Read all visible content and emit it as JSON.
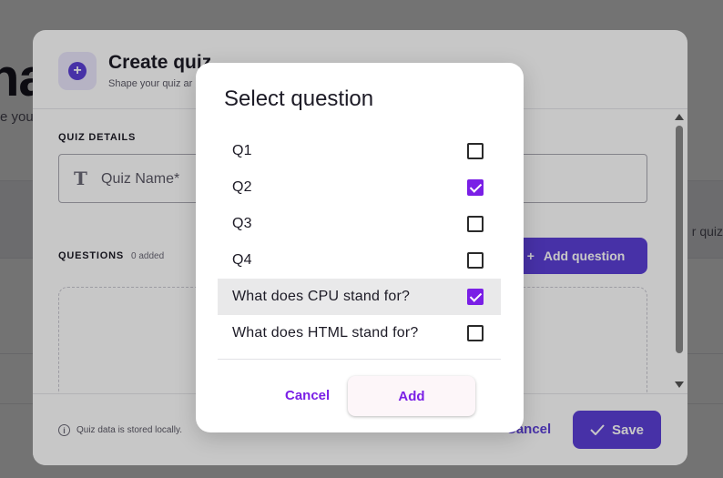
{
  "background": {
    "title_fragment": "na",
    "subtitle_fragment": "e your",
    "right_fragment": "r quiz"
  },
  "quiz_modal": {
    "title": "Create quiz",
    "subtitle": "Shape your quiz ar",
    "details_label": "QUIZ DETAILS",
    "name_placeholder": "Quiz Name*",
    "name_icon_glyph": "T",
    "questions_label": "QUESTIONS",
    "questions_count": "0 added",
    "add_question_label": "Add question",
    "footer_info": "Quiz data is stored locally.",
    "cancel_label": "Cancel",
    "save_label": "Save",
    "accent_color": "#5b3fd6"
  },
  "dialog": {
    "title": "Select question",
    "items": [
      {
        "label": "Q1",
        "checked": false
      },
      {
        "label": "Q2",
        "checked": true
      },
      {
        "label": "Q3",
        "checked": false
      },
      {
        "label": "Q4",
        "checked": false
      },
      {
        "label": "What does CPU stand for?",
        "checked": true,
        "hovered": true
      },
      {
        "label": "What does HTML stand for?",
        "checked": false
      }
    ],
    "cancel_label": "Cancel",
    "add_label": "Add",
    "accent_color": "#7a1fe6"
  }
}
